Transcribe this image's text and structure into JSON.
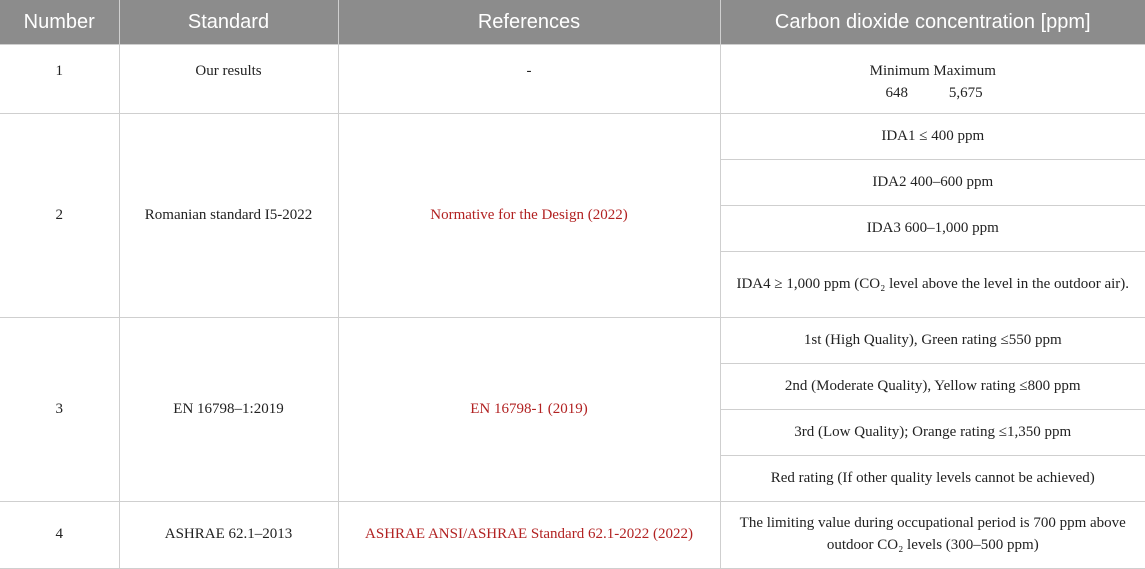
{
  "headers": [
    "Number",
    "Standard",
    "References",
    "Carbon dioxide concentration [ppm]"
  ],
  "rows": [
    {
      "number": "1",
      "standard": "Our results",
      "reference": "-",
      "minmax": {
        "min_label": "Minimum",
        "max_label": "Maximum",
        "min_value": "648",
        "max_value": "5,675"
      }
    },
    {
      "number": "2",
      "standard": "Romanian standard I5-2022",
      "reference": "Normative for the Design (2022)",
      "levels": [
        "IDA1 ≤ 400 ppm",
        "IDA2 400–600 ppm",
        "IDA3 600–1,000 ppm",
        "IDA4 ≥ 1,000 ppm (CO₂ level above the level in the outdoor air)."
      ]
    },
    {
      "number": "3",
      "standard": "EN 16798–1:2019",
      "reference": "EN 16798-1 (2019)",
      "levels": [
        "1st (High Quality), Green rating ≤550 ppm",
        "2nd (Moderate Quality), Yellow rating ≤800 ppm",
        "3rd (Low Quality); Orange rating ≤1,350 ppm",
        "Red rating (If other quality levels cannot be achieved)"
      ]
    },
    {
      "number": "4",
      "standard": "ASHRAE 62.1–2013",
      "reference": "ASHRAE ANSI/ASHRAE Standard 62.1-2022 (2022)",
      "value": "The limiting value during occupational period is 700 ppm above outdoor CO₂ levels (300–500 ppm)"
    }
  ]
}
